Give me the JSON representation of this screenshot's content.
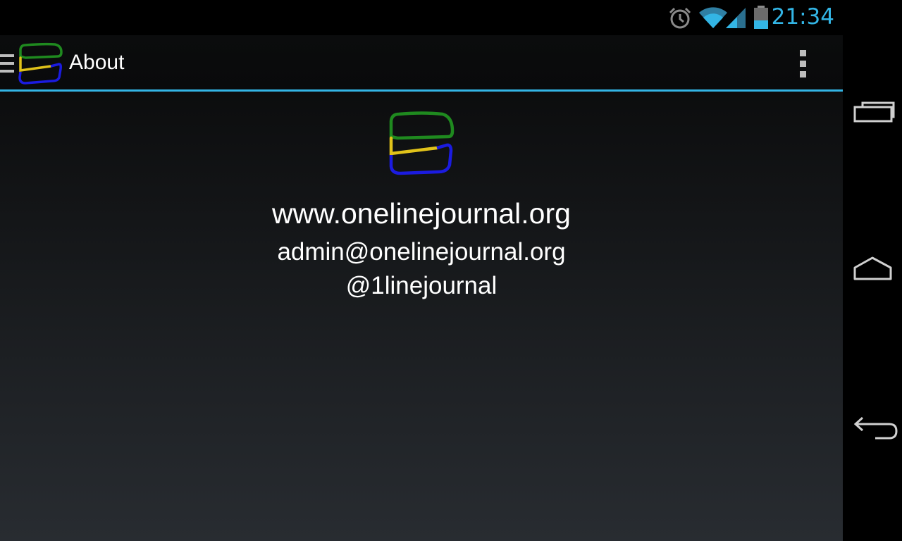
{
  "status_bar": {
    "time": "21:34",
    "icons": [
      "alarm-icon",
      "wifi-icon",
      "signal-icon",
      "battery-icon"
    ],
    "accent_color": "#33b5e5"
  },
  "action_bar": {
    "title": "About",
    "icons": [
      "drawer-indicator-icon",
      "app-logo-icon",
      "overflow-menu-icon"
    ]
  },
  "about": {
    "website": "www.onelinejournal.org",
    "email": "admin@onelinejournal.org",
    "twitter": "@1linejournal"
  },
  "logo_colors": {
    "top": "#1f8a1f",
    "middle": "#e0c21a",
    "bottom": "#1b1be0"
  },
  "nav_bar": {
    "buttons": [
      "recent-apps-icon",
      "home-icon",
      "back-icon"
    ]
  }
}
